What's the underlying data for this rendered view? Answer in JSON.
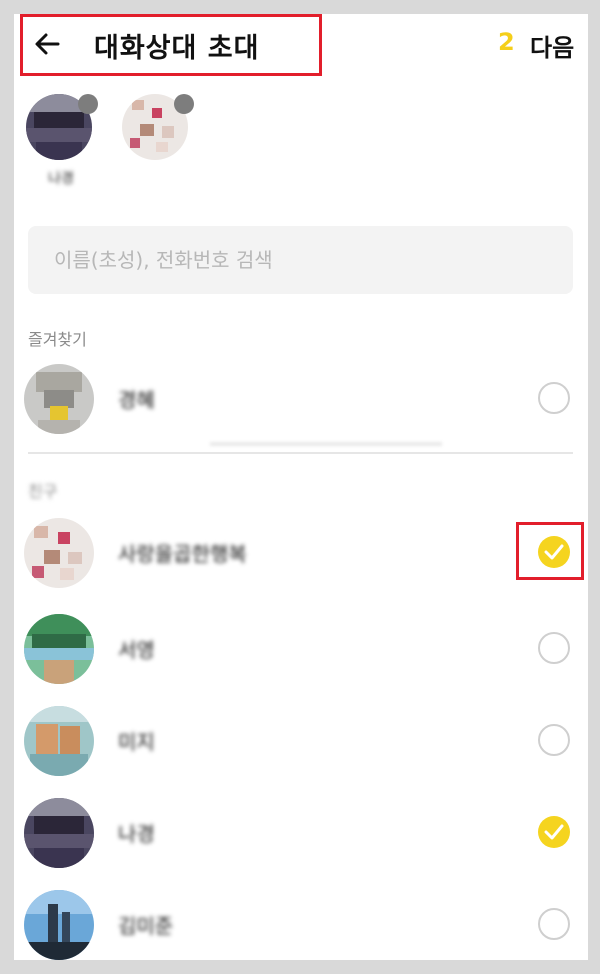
{
  "header": {
    "title": "대화상대 초대",
    "selected_count": "2",
    "next_label": "다음",
    "back_icon": "arrow-left-icon"
  },
  "colors": {
    "accent": "#f5cf1a",
    "check_fill": "#f5d41f",
    "annotation_red": "#e21e2b"
  },
  "selected": [
    {
      "name": "나경"
    },
    {
      "name": ""
    }
  ],
  "search": {
    "placeholder": "이름(초성), 전화번호 검색",
    "value": ""
  },
  "favorites": {
    "label": "즐겨찾기",
    "items": [
      {
        "name": "경혜",
        "checked": false
      }
    ]
  },
  "friends": {
    "label": "친구",
    "items": [
      {
        "name": "사랑을곱한행복",
        "checked": true
      },
      {
        "name": "서영",
        "checked": false
      },
      {
        "name": "미지",
        "checked": false
      },
      {
        "name": "나경",
        "checked": true
      },
      {
        "name": "김미준",
        "checked": false
      }
    ]
  }
}
